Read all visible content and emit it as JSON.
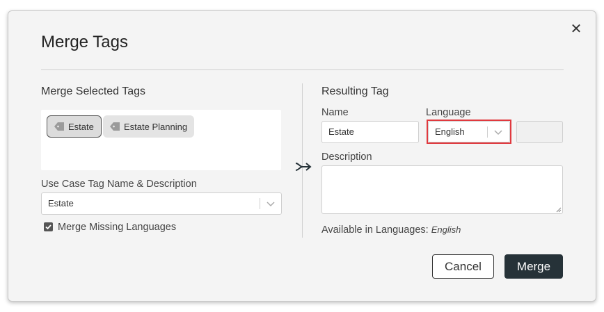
{
  "dialog": {
    "title": "Merge Tags",
    "close_icon": "close-icon"
  },
  "left": {
    "section_title": "Merge Selected Tags",
    "tags": [
      {
        "label": "Estate",
        "selected": true,
        "icon": "tag-icon"
      },
      {
        "label": "Estate Planning",
        "selected": false,
        "icon": "tag-icon"
      }
    ],
    "use_case_label": "Use Case Tag Name & Description",
    "use_case_value": "Estate",
    "merge_missing_label": "Merge Missing Languages",
    "merge_missing_checked": true
  },
  "arrow_icon": "merge-arrow-icon",
  "right": {
    "section_title": "Resulting Tag",
    "name_label": "Name",
    "name_value": "Estate",
    "language_label": "Language",
    "language_value": "English",
    "description_label": "Description",
    "description_value": "",
    "available_label": "Available in Languages:",
    "available_value": "English"
  },
  "buttons": {
    "cancel_label": "Cancel",
    "merge_label": "Merge"
  },
  "colors": {
    "highlight": "#e0393e",
    "primary_button": "#263238"
  }
}
